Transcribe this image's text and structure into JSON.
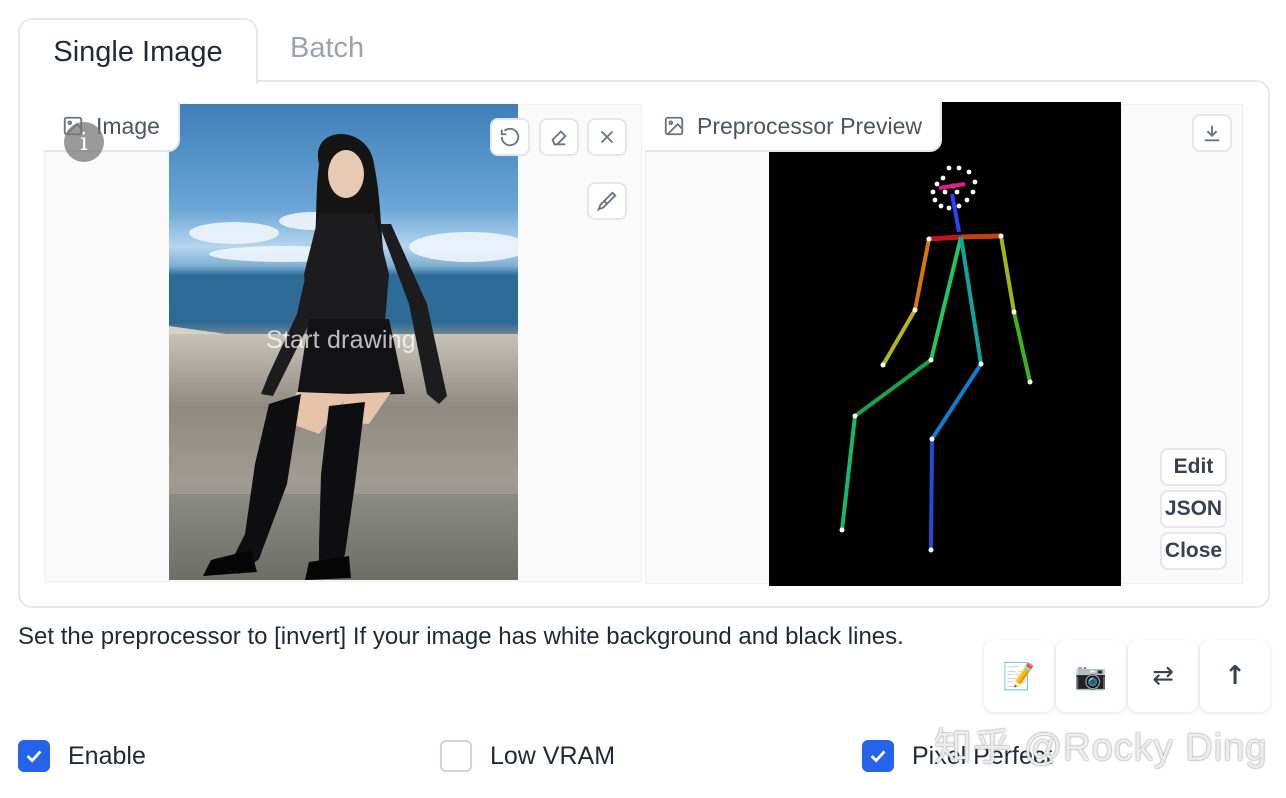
{
  "tabs": {
    "single": "Single Image",
    "batch": "Batch"
  },
  "input_panel": {
    "label": "Image",
    "overlay_text": "Start drawing"
  },
  "preview_panel": {
    "label": "Preprocessor Preview"
  },
  "side_buttons": {
    "edit": "Edit",
    "json": "JSON",
    "close": "Close"
  },
  "hint": "Set the preprocessor to [invert] If your image has white background and black lines.",
  "actions": [
    {
      "icon": "📝"
    },
    {
      "icon": "📷"
    },
    {
      "icon": "⇄"
    },
    {
      "icon": "↑"
    }
  ],
  "checkboxes": [
    {
      "label": "Enable",
      "checked": true
    },
    {
      "label": "Low VRAM",
      "checked": false
    },
    {
      "label": "Pixel Perfect",
      "checked": true
    }
  ],
  "watermark": "知乎 @Rocky Ding",
  "info_glyph": "i",
  "colors": {
    "accent": "#2563eb",
    "border": "#e5e7eb"
  }
}
